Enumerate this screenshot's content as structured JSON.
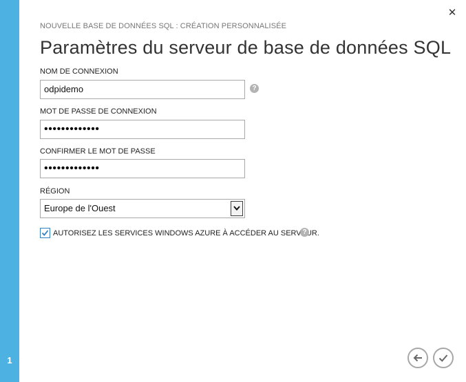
{
  "wizard": {
    "step_number": "1",
    "subtitle": "NOUVELLE BASE DE DONNÉES SQL : CRÉATION PERSONNALISÉE",
    "title": "Paramètres du serveur de base de données SQL",
    "close_symbol": "✕"
  },
  "form": {
    "login_name": {
      "label": "NOM DE CONNEXION",
      "value": "odpidemo"
    },
    "password": {
      "label": "MOT DE PASSE DE CONNEXION",
      "value": "•••••••••••••"
    },
    "confirm_password": {
      "label": "CONFIRMER LE MOT DE PASSE",
      "value": "•••••••••••••"
    },
    "region": {
      "label": "RÉGION",
      "value": "Europe de l'Ouest"
    },
    "allow_azure": {
      "label": "AUTORISEZ LES SERVICES WINDOWS AZURE À ACCÉDER AU SERVEUR.",
      "checked": true
    }
  },
  "help_glyph": "?",
  "icons": {
    "close": "close-icon",
    "help": "help-icon",
    "dropdown": "chevron-down-icon",
    "checkbox": "check-icon",
    "back": "arrow-left-icon",
    "finish": "check-icon"
  },
  "colors": {
    "side_strip": "#4db2e1",
    "button_border": "#a7a7a7",
    "checkbox_border": "#2f7fc1"
  }
}
